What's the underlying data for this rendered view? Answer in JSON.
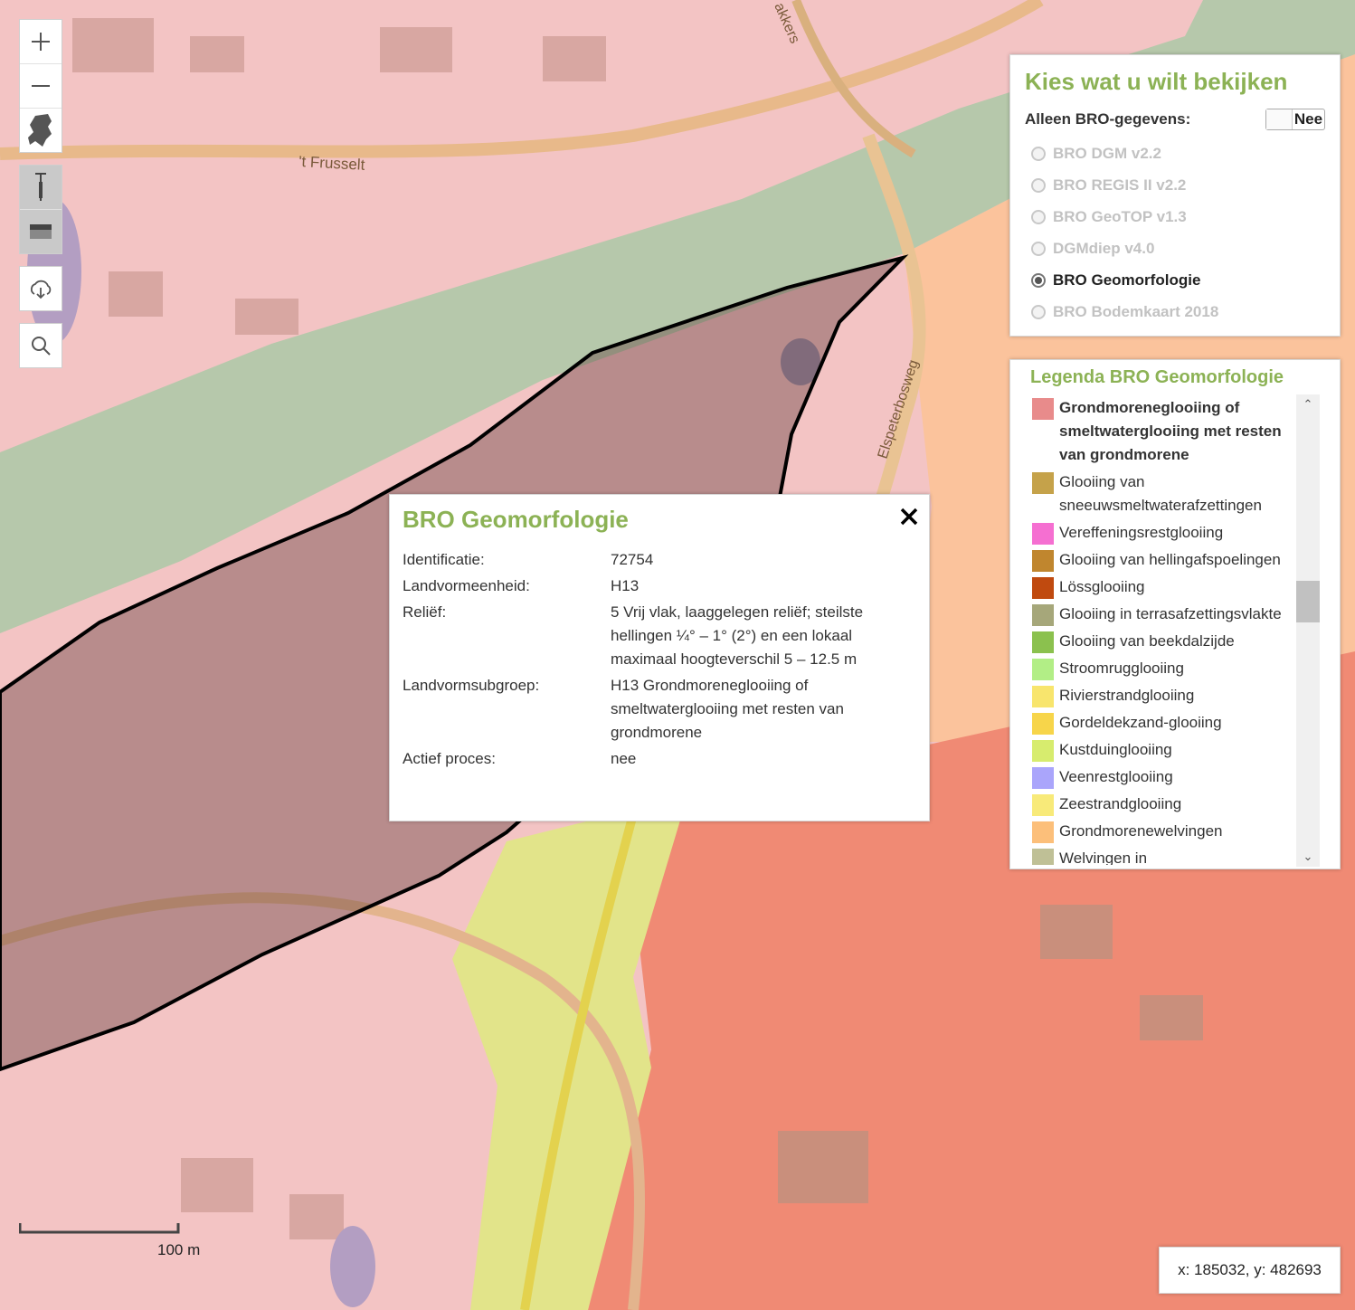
{
  "map": {
    "road_labels": [
      "'t Frusselt",
      "Elspeterbosweg",
      "akkers"
    ],
    "colors": {
      "grondmorene": "#f3c4c4",
      "selection_outline": "#000000"
    }
  },
  "controls": {
    "icons": [
      "zoom-in-icon",
      "zoom-out-icon",
      "netherlands-icon",
      "borehole-icon",
      "cross-section-icon",
      "cloud-download-icon",
      "search-icon"
    ]
  },
  "chooser": {
    "title": "Kies wat u wilt bekijken",
    "toggle_label": "Alleen BRO-gegevens:",
    "toggle_value": "Nee",
    "options": [
      {
        "label": "BRO DGM v2.2",
        "selected": false
      },
      {
        "label": "BRO REGIS II v2.2",
        "selected": false
      },
      {
        "label": "BRO GeoTOP v1.3",
        "selected": false
      },
      {
        "label": "DGMdiep v4.0",
        "selected": false
      },
      {
        "label": "BRO Geomorfologie",
        "selected": true
      },
      {
        "label": "BRO Bodemkaart 2018",
        "selected": false
      }
    ]
  },
  "legend": {
    "title": "Legenda BRO Geomorfologie",
    "items": [
      {
        "label": "Grondmoreneglooiing of smeltwaterglooiing met resten van grondmorene",
        "color": "#e88b8b",
        "selected": true
      },
      {
        "label": "Glooiing van sneeuwsmeltwaterafzettingen",
        "color": "#c5a24a",
        "selected": false
      },
      {
        "label": "Vereffeningsrestglooiing",
        "color": "#f56fd1",
        "selected": false
      },
      {
        "label": "Glooiing van hellingafspoelingen",
        "color": "#c0862e",
        "selected": false
      },
      {
        "label": "Lössglooiing",
        "color": "#c04a0f",
        "selected": false
      },
      {
        "label": "Glooiing in terrasafzettingsvlakte",
        "color": "#a6a77a",
        "selected": false
      },
      {
        "label": "Glooiing van beekdalzijde",
        "color": "#8bc14e",
        "selected": false
      },
      {
        "label": "Stroomrugglooiing",
        "color": "#b2ee86",
        "selected": false
      },
      {
        "label": "Rivierstrandglooiing",
        "color": "#f8e56d",
        "selected": false
      },
      {
        "label": "Gordeldekzand-glooiing",
        "color": "#f7d54a",
        "selected": false
      },
      {
        "label": "Kustduinglooiing",
        "color": "#d7ec6e",
        "selected": false
      },
      {
        "label": "Veenrestglooiing",
        "color": "#aaa5fb",
        "selected": false
      },
      {
        "label": "Zeestrandglooiing",
        "color": "#f8ea79",
        "selected": false
      },
      {
        "label": "Grondmorenewelvingen",
        "color": "#fcbf7a",
        "selected": false
      },
      {
        "label": "Welvingen in sneeuwsmeltwaterafzettingen",
        "color": "#bfc096",
        "selected": false
      }
    ]
  },
  "popup": {
    "title": "BRO Geomorfologie",
    "rows": [
      {
        "key": "Identificatie:",
        "value": "72754"
      },
      {
        "key": "Landvormeenheid:",
        "value": "H13"
      },
      {
        "key": "Reliëf:",
        "value": "5 Vrij vlak, laaggelegen reliëf; steilste hellingen ¼° – 1° (2°) en een lokaal maximaal hoogteverschil 5 – 12.5 m"
      },
      {
        "key": "Landvormsubgroep:",
        "value": "H13 Grondmoreneglooiing of smeltwaterglooiing met resten van grondmorene"
      },
      {
        "key": "Actief proces:",
        "value": "nee"
      }
    ]
  },
  "scale": {
    "label": "100 m"
  },
  "coords": {
    "text": "x: 185032, y: 482693"
  }
}
